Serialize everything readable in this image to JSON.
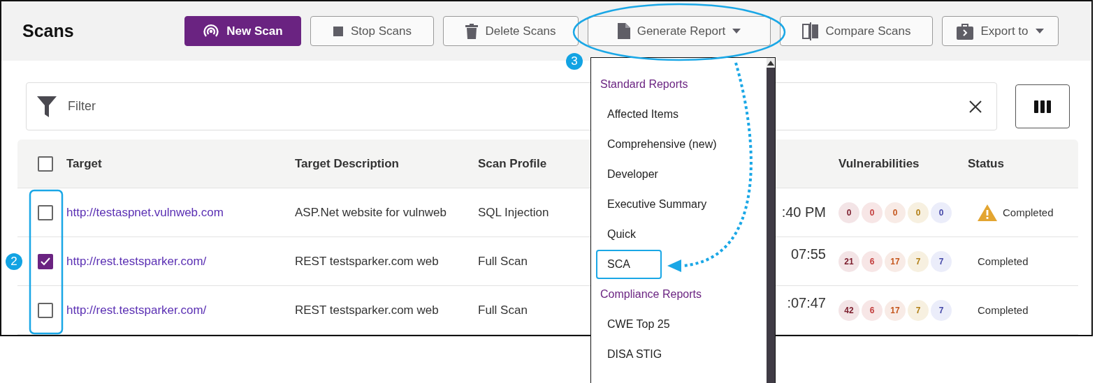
{
  "page": {
    "title": "Scans"
  },
  "toolbar": [
    {
      "label": "New Scan",
      "kind": "primary",
      "caret": false
    },
    {
      "label": "Stop Scans",
      "kind": "default",
      "caret": false
    },
    {
      "label": "Delete Scans",
      "kind": "default",
      "caret": false
    },
    {
      "label": "Generate Report",
      "kind": "default",
      "caret": true
    },
    {
      "label": "Compare Scans",
      "kind": "default",
      "caret": false
    },
    {
      "label": "Export to",
      "kind": "default",
      "caret": true
    }
  ],
  "filter": {
    "placeholder": "Filter"
  },
  "table": {
    "select_all": {
      "checked": false
    },
    "columns": [
      "Target",
      "Target Description",
      "Scan Profile",
      "Vulnerabilities",
      "Status"
    ],
    "rows": [
      {
        "checked": false,
        "target": "http://testaspnet.vulnweb.com",
        "description": "ASP.Net website for vulnweb",
        "profile": "SQL Injection",
        "column_4": ":40 PM",
        "vulnerabilities": [
          "0",
          "0",
          "0",
          "0",
          "0"
        ],
        "warning": true,
        "status": "Completed"
      },
      {
        "checked": true,
        "target": "http://rest.testsparker.com/",
        "description": "REST testsparker.com web",
        "profile": "Full Scan",
        "column_4": "07:55",
        "vulnerabilities": [
          "21",
          "6",
          "17",
          "7",
          "7"
        ],
        "warning": false,
        "status": "Completed"
      },
      {
        "checked": false,
        "target": "http://rest.testsparker.com/",
        "description": "REST testsparker.com web",
        "profile": "Full Scan",
        "column_4": ":07:47",
        "vulnerabilities": [
          "42",
          "6",
          "17",
          "7",
          "7"
        ],
        "warning": false,
        "status": "Completed"
      }
    ]
  },
  "report_menu": {
    "groups": [
      {
        "label": "Standard Reports",
        "items": [
          {
            "label": "Affected Items",
            "highlighted": false
          },
          {
            "label": "Comprehensive (new)",
            "highlighted": false
          },
          {
            "label": "Developer",
            "highlighted": false
          },
          {
            "label": "Executive Summary",
            "highlighted": false
          },
          {
            "label": "Quick",
            "highlighted": false
          },
          {
            "label": "SCA",
            "highlighted": true
          }
        ]
      },
      {
        "label": "Compliance Reports",
        "items": [
          {
            "label": "CWE Top 25",
            "highlighted": false
          },
          {
            "label": "DISA STIG",
            "highlighted": false
          }
        ]
      }
    ]
  },
  "callouts": [
    {
      "label": "3"
    },
    {
      "label": "2"
    }
  ]
}
